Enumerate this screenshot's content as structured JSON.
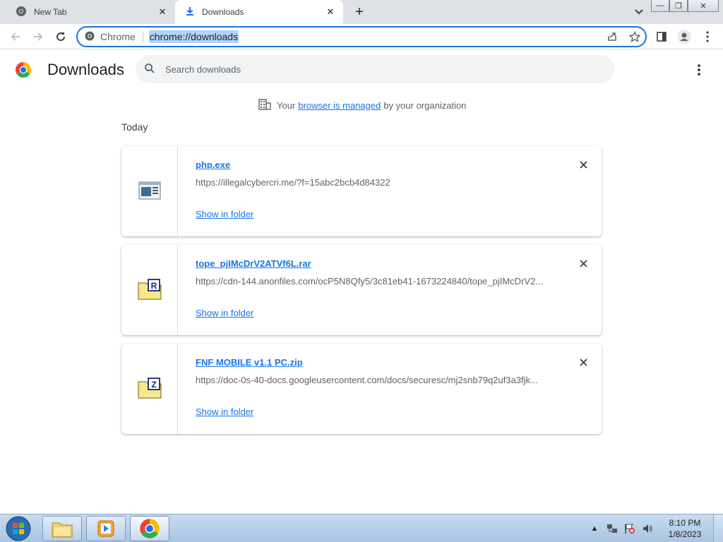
{
  "browser": {
    "tabs": [
      {
        "title": "New Tab",
        "active": false,
        "icon": "chrome-favicon"
      },
      {
        "title": "Downloads",
        "active": true,
        "icon": "download-icon"
      }
    ],
    "new_tab_label": "+",
    "omnibox": {
      "chip_label": "Chrome",
      "url": "chrome://downloads"
    }
  },
  "page": {
    "title": "Downloads",
    "search_placeholder": "Search downloads",
    "managed_notice": {
      "prefix": "Your",
      "link": "browser is managed",
      "suffix": "by your organization"
    },
    "section_label": "Today",
    "downloads": [
      {
        "name": "php.exe",
        "url": "https://illegalcybercri.me/?f=15abc2bcb4d84322",
        "action": "Show in folder",
        "icon": "exe-file-icon"
      },
      {
        "name": "tope_pjIMcDrV2ATVf6L.rar",
        "url": "https://cdn-144.anonfiles.com/ocP5N8Qfy5/3c81eb41-1673224840/tope_pjIMcDrV2...",
        "action": "Show in folder",
        "icon": "rar-archive-icon"
      },
      {
        "name": "FNF MOBILE v1.1 PC.zip",
        "url": "https://doc-0s-40-docs.googleusercontent.com/docs/securesc/mj2snb79q2uf3a3fjk...",
        "action": "Show in folder",
        "icon": "zip-archive-icon"
      }
    ]
  },
  "taskbar": {
    "clock_time": "8:10 PM",
    "clock_date": "1/8/2023"
  },
  "colors": {
    "accent": "#1a73e8",
    "tabstrip": "#dee1e6",
    "search_bg": "#f1f3f4"
  }
}
